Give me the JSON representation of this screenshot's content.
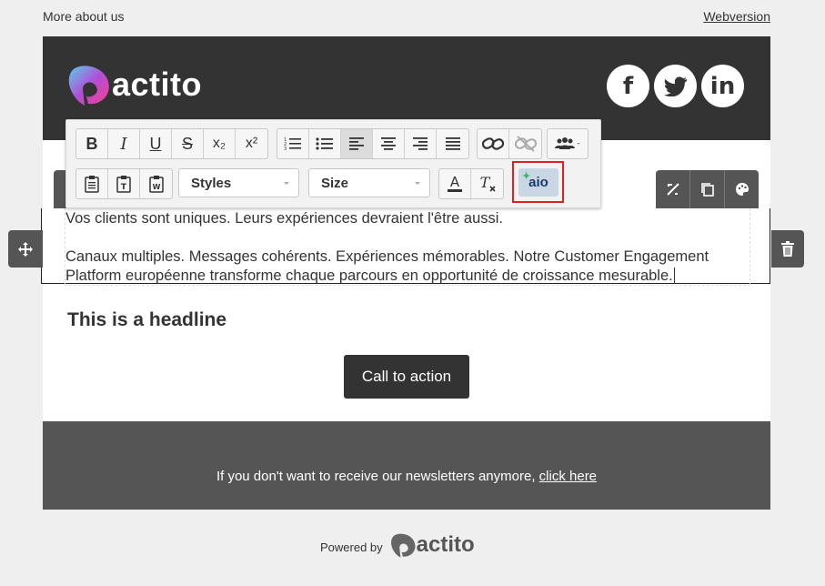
{
  "top": {
    "more_label": "More about us",
    "webversion_label": "Webversion"
  },
  "header": {
    "logo_text": "actito",
    "social": [
      "f",
      "twitter",
      "in"
    ]
  },
  "toolbar": {
    "row1": [
      "B",
      "I",
      "U",
      "S",
      "x₂",
      "x²"
    ],
    "styles_label": "Styles",
    "size_label": "Size",
    "aio_label": "aio"
  },
  "content": {
    "p1": "Vos clients sont uniques. Leurs expériences devraient l'être aussi.",
    "p2_line1": "Canaux multiples. Messages cohérents. Expériences mémorables. Notre Customer Engagement",
    "p2_line2": "Platform européenne transforme chaque parcours en opportunité de croissance mesurable.",
    "headline": "This is a headline",
    "cta_label": "Call to action"
  },
  "footer": {
    "text": "If you don't want to receive our newsletters anymore, ",
    "link": "click here"
  },
  "powered": {
    "label": "Powered by",
    "brand": "actito"
  },
  "colors": {
    "accent": "#e02020",
    "dark": "#333333",
    "footer": "#555555"
  }
}
